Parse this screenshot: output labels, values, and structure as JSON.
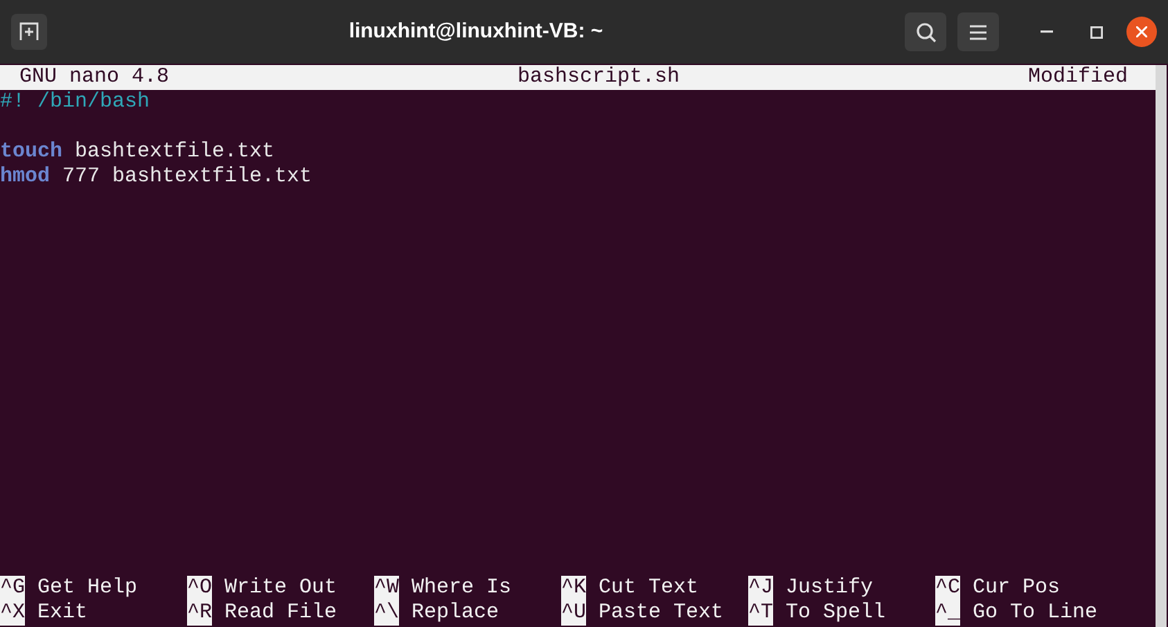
{
  "window": {
    "title": "linuxhint@linuxhint-VB: ~"
  },
  "nano_header": {
    "version": "GNU nano 4.8",
    "filename": "bashscript.sh",
    "status": "Modified"
  },
  "lines": [
    {
      "kind": "code",
      "tokens": [
        {
          "kind": "comment",
          "text": "#! /bin/bash"
        }
      ]
    },
    {
      "kind": "blank"
    },
    {
      "kind": "code",
      "tokens": [
        {
          "kind": "keyword",
          "text": "touch"
        },
        {
          "kind": "plain",
          "text": " bashtextfile.txt"
        }
      ]
    },
    {
      "kind": "code",
      "tokens": [
        {
          "kind": "keyword",
          "text": "hmod"
        },
        {
          "kind": "plain",
          "text": " 777 bashtextfile.txt"
        }
      ]
    }
  ],
  "shortcuts": [
    [
      {
        "key": "^G",
        "label": "Get Help"
      },
      {
        "key": "^O",
        "label": "Write Out"
      },
      {
        "key": "^W",
        "label": "Where Is"
      },
      {
        "key": "^K",
        "label": "Cut Text"
      },
      {
        "key": "^J",
        "label": "Justify"
      },
      {
        "key": "^C",
        "label": "Cur Pos"
      }
    ],
    [
      {
        "key": "^X",
        "label": "Exit"
      },
      {
        "key": "^R",
        "label": "Read File"
      },
      {
        "key": "^\\",
        "label": "Replace"
      },
      {
        "key": "^U",
        "label": "Paste Text"
      },
      {
        "key": "^T",
        "label": "To Spell"
      },
      {
        "key": "^_",
        "label": "Go To Line"
      }
    ]
  ]
}
